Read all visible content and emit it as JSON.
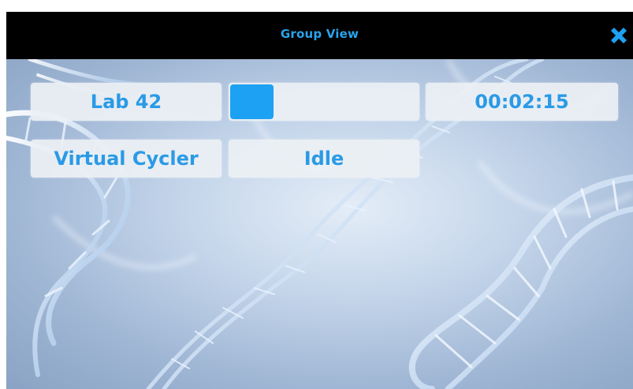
{
  "window": {
    "title": "Group View",
    "close_icon": "close-icon"
  },
  "group": {
    "lab_name": "Lab 42",
    "progress": 0.23,
    "elapsed_time": "00:02:15",
    "instrument": "Virtual Cycler",
    "status": "Idle"
  },
  "background": {
    "subject": "dna-helix-illustration"
  },
  "colors": {
    "title_bar": "#000000",
    "accent": "#1da1f2",
    "text": "#2a9ae6",
    "tile": "#eceff3"
  }
}
